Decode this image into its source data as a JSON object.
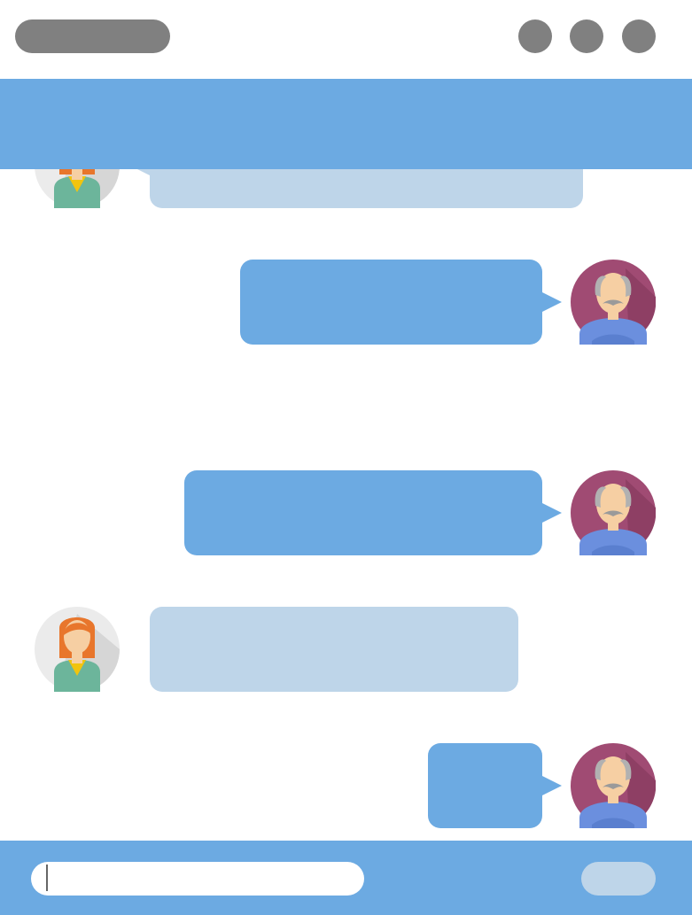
{
  "colors": {
    "accent": "#6caae2",
    "incoming_bubble": "#bed5e9",
    "window_button": "#808080",
    "background": "#ffffff",
    "send_button": "#bed5e9"
  },
  "window": {
    "title": "",
    "buttons": [
      "window-button-1",
      "window-button-2",
      "window-button-3"
    ]
  },
  "header": {
    "title": ""
  },
  "messages": [
    {
      "sender": "woman",
      "direction": "incoming",
      "text": ""
    },
    {
      "sender": "old-man",
      "direction": "outgoing",
      "text": ""
    },
    {
      "sender": "old-man",
      "direction": "outgoing",
      "text": ""
    },
    {
      "sender": "woman",
      "direction": "incoming",
      "text": ""
    },
    {
      "sender": "old-man",
      "direction": "outgoing",
      "text": ""
    }
  ],
  "composer": {
    "value": "",
    "placeholder": "",
    "send_label": ""
  },
  "icons": {
    "woman_avatar": "woman-avatar-icon",
    "old_man_avatar": "old-man-avatar-icon"
  }
}
